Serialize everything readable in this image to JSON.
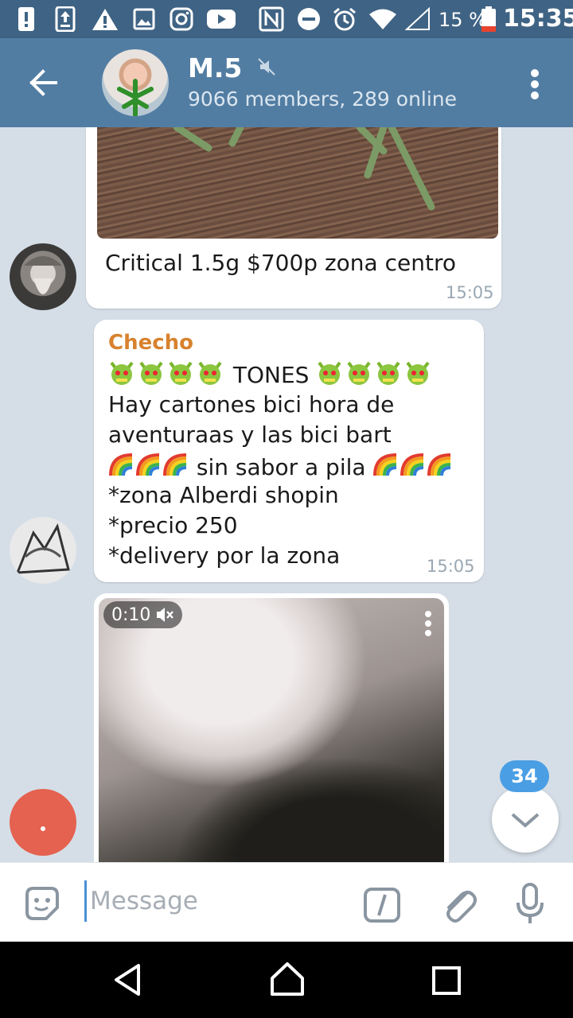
{
  "status_bar": {
    "battery_percent": "15 %",
    "time": "15:35"
  },
  "header": {
    "title": "M.5",
    "subtitle": "9066 members, 289 online"
  },
  "messages": [
    {
      "text": "Critical 1.5g $700p zona centro",
      "time": "15:05"
    },
    {
      "sender": "Checho",
      "line_1": "TONES",
      "line_2": "Hay cartones bici hora de",
      "line_3": "aventuraas y las bici bart",
      "line_4": "sin sabor a pila",
      "line_5": "*zona Alberdi shopin",
      "line_6": "*precio 250",
      "line_7": "*delivery por la zona",
      "time": "15:05"
    },
    {
      "video_duration": "0:10"
    }
  ],
  "unread_count": "34",
  "composer": {
    "placeholder": "Message"
  },
  "colors": {
    "status_bar": "#3f6384",
    "header": "#527da3",
    "chat_bg": "#d5dee7",
    "sender_name": "#d8822e",
    "badge": "#4a9ee4"
  }
}
